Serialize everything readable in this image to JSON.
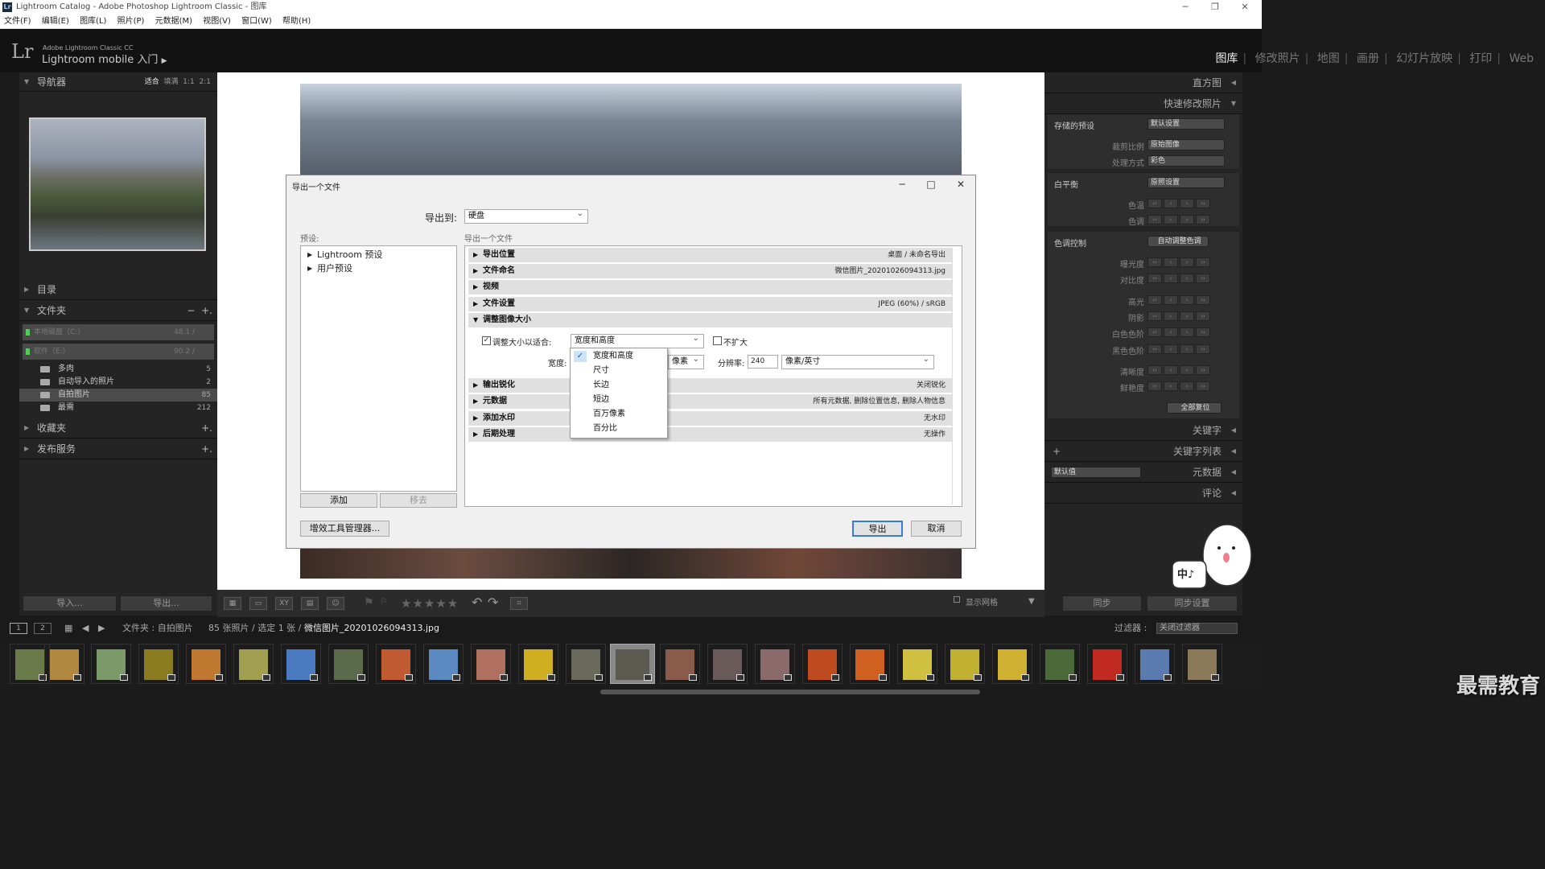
{
  "window": {
    "title": "Lightroom Catalog - Adobe Photoshop Lightroom Classic - 图库",
    "logo": "Lr",
    "minimize": "─",
    "restore": "❐",
    "close": "✕"
  },
  "menu": [
    "文件(F)",
    "编辑(E)",
    "图库(L)",
    "照片(P)",
    "元数据(M)",
    "视图(V)",
    "窗口(W)",
    "帮助(H)"
  ],
  "header": {
    "logo": "Lr",
    "brand": "Adobe Lightroom Classic CC",
    "mobile": "Lightroom mobile 入门",
    "arrow": "▶",
    "modules": [
      {
        "label": "图库"
      },
      {
        "label": "修改照片"
      },
      {
        "label": "地图"
      },
      {
        "label": "画册"
      },
      {
        "label": "幻灯片放映"
      },
      {
        "label": "打印"
      },
      {
        "label": "Web"
      }
    ],
    "separator": "|"
  },
  "left": {
    "navigator": "导航器",
    "zoom": [
      "适合",
      "填满",
      "1:1",
      "2:1"
    ],
    "catalog": "目录",
    "folders": "文件夹",
    "folders_actions": [
      "−",
      "+."
    ],
    "volumes": [
      {
        "name": "本地磁盘（C:）",
        "size": "48.1 /"
      },
      {
        "name": "软件（E:）",
        "size": "90.2 /"
      }
    ],
    "folder_items": [
      {
        "name": "多肉",
        "count": "5"
      },
      {
        "name": "自动导入的照片",
        "count": "2"
      },
      {
        "name": "自拍图片",
        "count": "85"
      },
      {
        "name": "最需",
        "count": "212"
      }
    ],
    "collections": "收藏夹",
    "publish": "发布服务",
    "plus": "+.",
    "import": "导入...",
    "export": "导出..."
  },
  "dialog": {
    "title": "导出一个文件",
    "export_to_label": "导出到:",
    "export_to_value": "硬盘",
    "presets_label": "预设:",
    "section_header": "导出一个文件",
    "preset_items": [
      "Lightroom 预设",
      "用户预设"
    ],
    "add": "添加",
    "remove": "移去",
    "plugin_manager": "增效工具管理器...",
    "export_btn": "导出",
    "cancel_btn": "取消",
    "sections": [
      {
        "name": "导出位置",
        "value": "桌面 / 未命名导出"
      },
      {
        "name": "文件命名",
        "value": "微信图片_20201026094313.jpg"
      },
      {
        "name": "视频",
        "value": ""
      },
      {
        "name": "文件设置",
        "value": "JPEG (60%) / sRGB"
      },
      {
        "name": "调整图像大小",
        "value": ""
      }
    ],
    "sections2": [
      {
        "name": "输出锐化",
        "value": "关闭锐化"
      },
      {
        "name": "元数据",
        "value": "所有元数据, 删除位置信息, 删除人物信息"
      },
      {
        "name": "添加水印",
        "value": "无水印"
      },
      {
        "name": "后期处理",
        "value": "无操作"
      }
    ],
    "resize": {
      "fit_label": "调整大小以适合:",
      "fit_value": "宽度和高度",
      "no_enlarge": "不扩大",
      "width_label": "宽度:",
      "unit": "像素",
      "resolution_label": "分辨率:",
      "resolution": "240",
      "res_unit": "像素/英寸"
    },
    "dropdown": [
      "宽度和高度",
      "尺寸",
      "长边",
      "短边",
      "百万像素",
      "百分比"
    ]
  },
  "right": {
    "histogram": "直方图",
    "quick_develop": "快速修改照片",
    "saved_preset": "存储的预设",
    "saved_preset_value": "默认设置",
    "crop": "裁剪比例",
    "crop_value": "原始图像",
    "treatment": "处理方式",
    "treatment_value": "彩色",
    "wb": "白平衡",
    "wb_value": "原照设置",
    "temp": "色温",
    "tint": "色调",
    "tone": "色调控制",
    "auto_tone": "自动调整色调",
    "tone_items": [
      "曝光度",
      "对比度",
      "高光",
      "阴影",
      "白色色阶",
      "黑色色阶",
      "清晰度",
      "鲜艳度"
    ],
    "reset": "全部复位",
    "keywords": "关键字",
    "keyword_list": "关键字列表",
    "metadata": "元数据",
    "metadata_preset": "默认值",
    "comments": "评论",
    "sync": "同步",
    "sync_settings": "同步设置",
    "plus": "+"
  },
  "toolbar": {
    "stars": "★★★★★",
    "show_grid": "显示网格"
  },
  "filmstrip": {
    "pages": [
      "1",
      "2"
    ],
    "path": "文件夹 : 自拍图片",
    "count": "85 张照片 / 选定 1 张 /",
    "file": "微信图片_20201026094313.jpg",
    "filter_label": "过滤器 :",
    "filter_value": "关闭过滤器"
  },
  "watermark": "最需教育",
  "mascot_text": "中♪"
}
